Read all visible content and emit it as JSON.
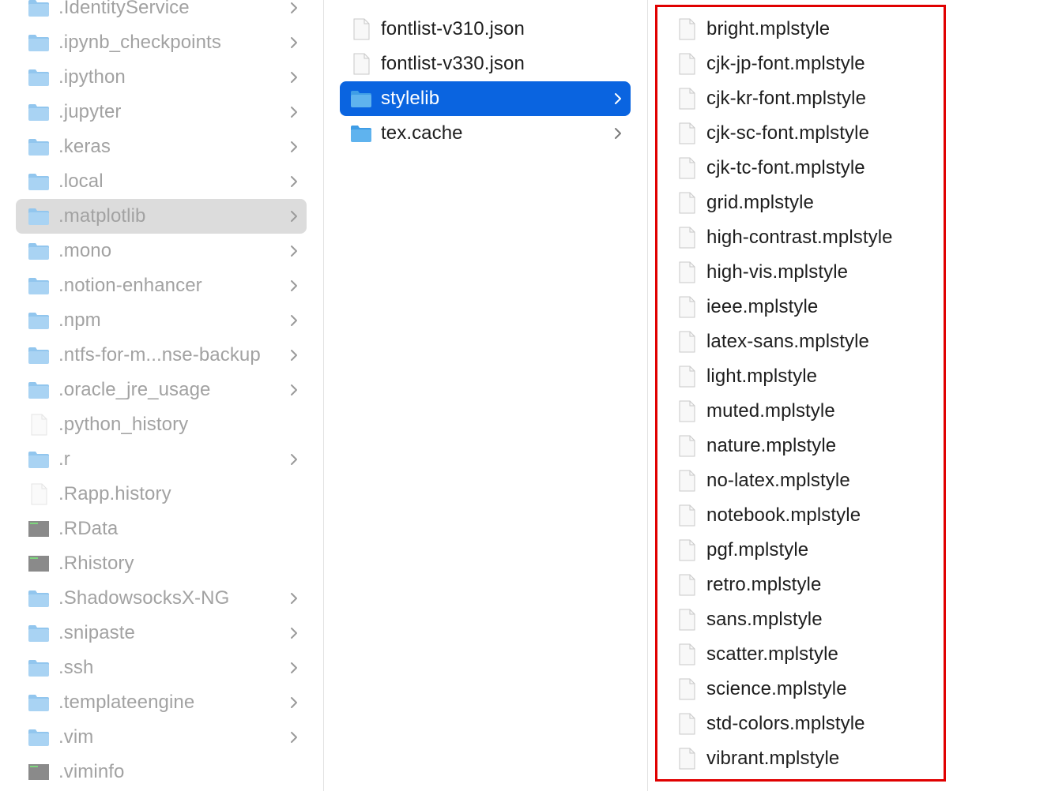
{
  "columns": {
    "home": {
      "items": [
        {
          "label": ".IdentityService",
          "kind": "folder",
          "arrow": true
        },
        {
          "label": ".ipynb_checkpoints",
          "kind": "folder",
          "arrow": true
        },
        {
          "label": ".ipython",
          "kind": "folder",
          "arrow": true
        },
        {
          "label": ".jupyter",
          "kind": "folder",
          "arrow": true
        },
        {
          "label": ".keras",
          "kind": "folder",
          "arrow": true
        },
        {
          "label": ".local",
          "kind": "folder",
          "arrow": true
        },
        {
          "label": ".matplotlib",
          "kind": "folder",
          "arrow": true,
          "selected": true
        },
        {
          "label": ".mono",
          "kind": "folder",
          "arrow": true
        },
        {
          "label": ".notion-enhancer",
          "kind": "folder",
          "arrow": true
        },
        {
          "label": ".npm",
          "kind": "folder",
          "arrow": true
        },
        {
          "label": ".ntfs-for-m...nse-backup",
          "kind": "folder",
          "arrow": true
        },
        {
          "label": ".oracle_jre_usage",
          "kind": "folder",
          "arrow": true
        },
        {
          "label": ".python_history",
          "kind": "file",
          "arrow": false
        },
        {
          "label": ".r",
          "kind": "folder",
          "arrow": true
        },
        {
          "label": ".Rapp.history",
          "kind": "file",
          "arrow": false
        },
        {
          "label": ".RData",
          "kind": "exec",
          "arrow": false
        },
        {
          "label": ".Rhistory",
          "kind": "exec",
          "arrow": false
        },
        {
          "label": ".ShadowsocksX-NG",
          "kind": "folder",
          "arrow": true
        },
        {
          "label": ".snipaste",
          "kind": "folder",
          "arrow": true
        },
        {
          "label": ".ssh",
          "kind": "folder",
          "arrow": true
        },
        {
          "label": ".templateengine",
          "kind": "folder",
          "arrow": true
        },
        {
          "label": ".vim",
          "kind": "folder",
          "arrow": true
        },
        {
          "label": ".viminfo",
          "kind": "exec",
          "arrow": false
        }
      ]
    },
    "matplotlib": {
      "items": [
        {
          "label": "fontlist-v310.json",
          "kind": "file",
          "arrow": false
        },
        {
          "label": "fontlist-v330.json",
          "kind": "file",
          "arrow": false
        },
        {
          "label": "stylelib",
          "kind": "folder",
          "arrow": true,
          "selected": true
        },
        {
          "label": "tex.cache",
          "kind": "folder",
          "arrow": true
        }
      ]
    },
    "stylelib": {
      "items": [
        {
          "label": "bright.mplstyle",
          "kind": "file"
        },
        {
          "label": "cjk-jp-font.mplstyle",
          "kind": "file"
        },
        {
          "label": "cjk-kr-font.mplstyle",
          "kind": "file"
        },
        {
          "label": "cjk-sc-font.mplstyle",
          "kind": "file"
        },
        {
          "label": "cjk-tc-font.mplstyle",
          "kind": "file"
        },
        {
          "label": "grid.mplstyle",
          "kind": "file"
        },
        {
          "label": "high-contrast.mplstyle",
          "kind": "file"
        },
        {
          "label": "high-vis.mplstyle",
          "kind": "file"
        },
        {
          "label": "ieee.mplstyle",
          "kind": "file"
        },
        {
          "label": "latex-sans.mplstyle",
          "kind": "file"
        },
        {
          "label": "light.mplstyle",
          "kind": "file"
        },
        {
          "label": "muted.mplstyle",
          "kind": "file"
        },
        {
          "label": "nature.mplstyle",
          "kind": "file"
        },
        {
          "label": "no-latex.mplstyle",
          "kind": "file"
        },
        {
          "label": "notebook.mplstyle",
          "kind": "file"
        },
        {
          "label": "pgf.mplstyle",
          "kind": "file"
        },
        {
          "label": "retro.mplstyle",
          "kind": "file"
        },
        {
          "label": "sans.mplstyle",
          "kind": "file"
        },
        {
          "label": "scatter.mplstyle",
          "kind": "file"
        },
        {
          "label": "science.mplstyle",
          "kind": "file"
        },
        {
          "label": "std-colors.mplstyle",
          "kind": "file"
        },
        {
          "label": "vibrant.mplstyle",
          "kind": "file"
        }
      ]
    }
  },
  "colors": {
    "selection_active": "#0a64e0",
    "selection_inactive": "#dcdcdc",
    "highlight_box": "#e00000",
    "folder": "#5fb3ee",
    "folder_dim": "#a9d3f3"
  },
  "icons": {
    "folder": "folder-icon",
    "file": "document-icon",
    "exec": "terminal-exec-icon",
    "arrow": "chevron-right-icon"
  }
}
